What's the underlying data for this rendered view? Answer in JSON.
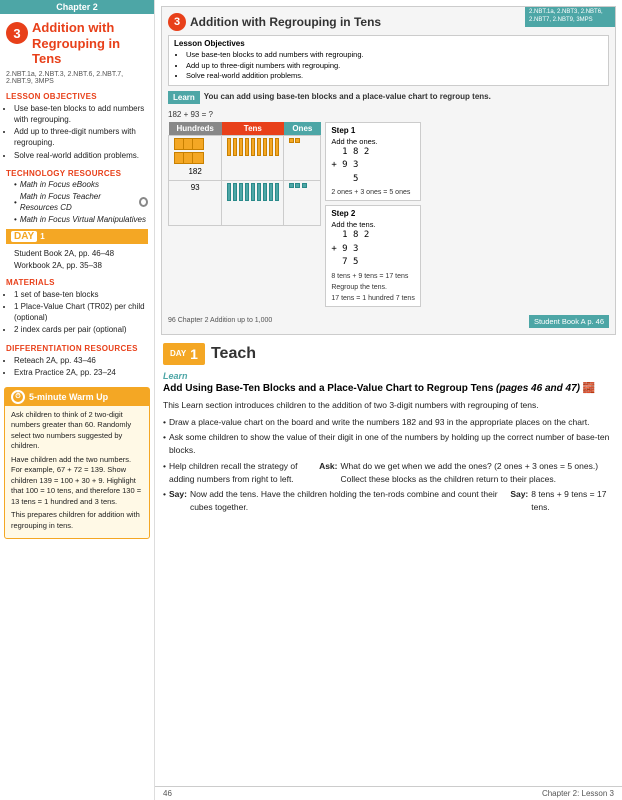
{
  "left": {
    "chapter_header": "Chapter 2",
    "lesson_number": "3",
    "lesson_title_line1": "Addition with",
    "lesson_title_line2": "Regrouping in Tens",
    "common_core": "2.NBT.1a, 2.NBT.3, 2.NBT.6, 2.NBT.7, 2.NBT.9, 3MPS",
    "lesson_objectives_header": "LESSON OBJECTIVES",
    "objectives": [
      "Use base-ten blocks to add numbers with regrouping.",
      "Add up to three-digit numbers with regrouping.",
      "Solve real-world addition problems."
    ],
    "tech_resources_header": "TECHNOLOGY RESOURCES",
    "tech_resources": [
      "Math in Focus eBooks",
      "Math in Focus Teacher Resources CD",
      "Math in Focus Virtual Manipulatives"
    ],
    "day_label": "DAY",
    "day_number": "1",
    "day_content_line1": "Student Book 2A, pp. 46–48",
    "day_content_line2": "Workbook 2A, pp. 35–38",
    "materials_header": "MATERIALS",
    "materials": [
      "1 set of base-ten blocks",
      "1 Place-Value Chart (TR02) per child (optional)",
      "2 index cards per pair (optional)"
    ],
    "diff_resources_header": "DIFFERENTIATION RESOURCES",
    "diff_resources": [
      "Reteach 2A, pp. 43–46",
      "Extra Practice 2A, pp. 23–24"
    ],
    "warm_up_title": "5-minute Warm Up",
    "warm_up_bullets": [
      "Ask children to think of 2 two-digit numbers greater than 60. Randomly select two numbers suggested by children.",
      "Have children add the two numbers. For example, 67 + 72 = 139. Show children 139 = 100 + 30 + 9. Highlight that 100 = 10 tens, and therefore 130 = 13 tens = 1 hundred and 3 tens.",
      "This prepares children for addition with regrouping in tens."
    ]
  },
  "right": {
    "standards": "2.NBT.1a, 2.NBT3, 2.NBT6, 2.NBT7, 2.NBT9, 3MPS",
    "lesson_number": "3",
    "lesson_title": "Addition with Regrouping in Tens",
    "objectives_title": "Lesson Objectives",
    "objectives": [
      "Use base-ten blocks to add numbers with regrouping.",
      "Add up to three-digit numbers with regrouping.",
      "Solve real-world addition problems."
    ],
    "learn_banner": "Learn",
    "learn_description": "You can add using base-ten blocks and a place-value chart to regroup tens.",
    "equation": "182 + 93 = ?",
    "pv_headers": [
      "Hundreds",
      "Tens",
      "Ones"
    ],
    "step1_title": "Step 1",
    "step1_desc": "Add the ones.",
    "step1_math": [
      "  1 8 2",
      "+ 9 3",
      "    5"
    ],
    "step1_note": "2 ones + 3 ones = 5 ones",
    "step2_title": "Step 2",
    "step2_desc": "Add the tens.",
    "step2_math": [
      "  1 8 2",
      "+ 9 3",
      "  7 5"
    ],
    "step2_note1": "8 tens + 9 tens = 17 tens",
    "step2_note2": "Regroup the tens.",
    "step2_note3": "17 tens = 1 hundred 7 tens",
    "page_ref": "Student Book A p. 46",
    "page_number_bottom_left": "96   Chapter 2  Addition up to 1,000",
    "teach_day": "DAY",
    "teach_day_num": "1",
    "teach_title": "Teach",
    "learn_sublabel": "Learn",
    "teach_section_title_bold": "Add Using Base-Ten Blocks and a Place-Value Chart to Regroup Tens",
    "teach_section_pages": "(pages 46 and 47)",
    "teach_intro": "This Learn section introduces children to the addition of two 3-digit numbers with regrouping of tens.",
    "teach_bullets": [
      "Draw a place-value chart on the board and write the numbers 182 and 93 in the appropriate places on the chart.",
      "Ask some children to show the value of their digit in one of the numbers by holding up the correct number of base-ten blocks.",
      "Help children recall the strategy of adding numbers from right to left. Ask: What do we get when we add the ones? (2 ones + 3 ones = 5 ones.) Collect these blocks as the children return to their places.",
      "Say: Now add the tens. Have the children holding the ten-rods combine and count their cubes together. Say: 8 tens + 9 tens = 17 tens."
    ],
    "bottom_page_left": "46",
    "bottom_page_right": "Chapter 2: Lesson 3"
  }
}
